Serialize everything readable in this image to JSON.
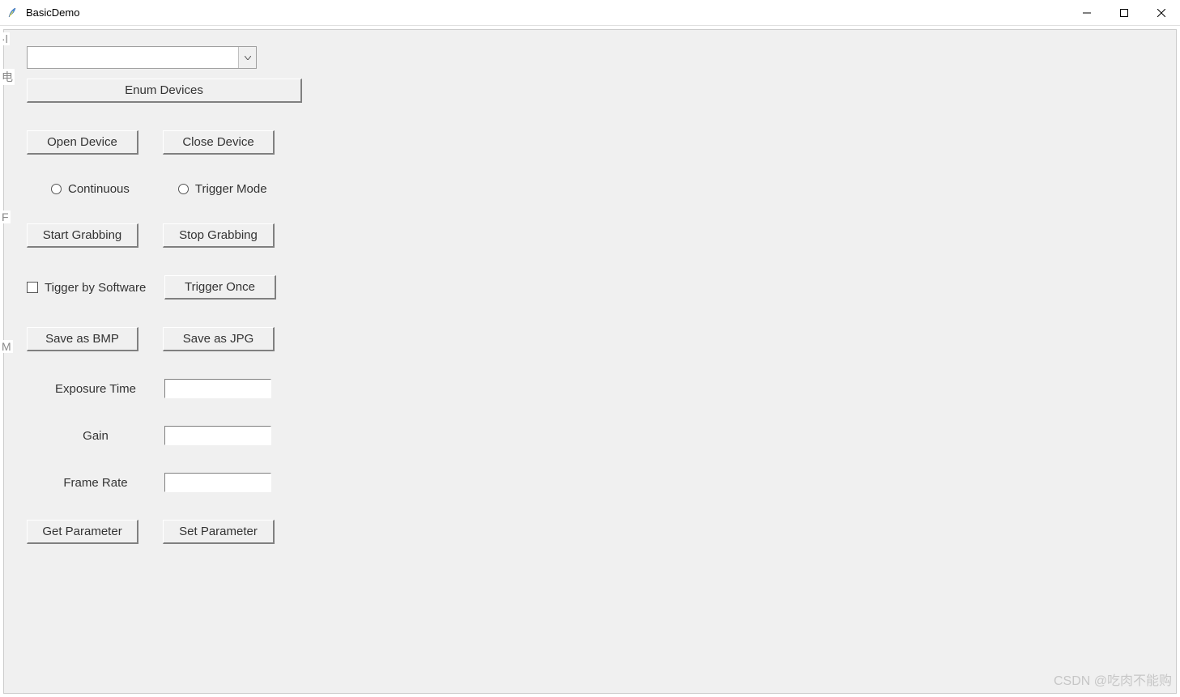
{
  "window": {
    "title": "BasicDemo"
  },
  "device_combo": {
    "value": ""
  },
  "buttons": {
    "enum_devices": "Enum Devices",
    "open_device": "Open Device",
    "close_device": "Close Device",
    "start_grabbing": "Start Grabbing",
    "stop_grabbing": "Stop Grabbing",
    "trigger_once": "Trigger Once",
    "save_bmp": "Save as BMP",
    "save_jpg": "Save as JPG",
    "get_parameter": "Get Parameter",
    "set_parameter": "Set Parameter"
  },
  "radios": {
    "continuous": "Continuous",
    "trigger_mode": "Trigger Mode"
  },
  "checks": {
    "trigger_software": "Tigger by Software"
  },
  "params": {
    "exposure_label": "Exposure Time",
    "gain_label": "Gain",
    "frame_rate_label": "Frame Rate",
    "exposure_value": "",
    "gain_value": "",
    "frame_rate_value": ""
  },
  "watermark": "CSDN @吃肉不能购",
  "left_fragments": {
    "a": "·l",
    "b": "电",
    "c": "F",
    "d": "M"
  }
}
